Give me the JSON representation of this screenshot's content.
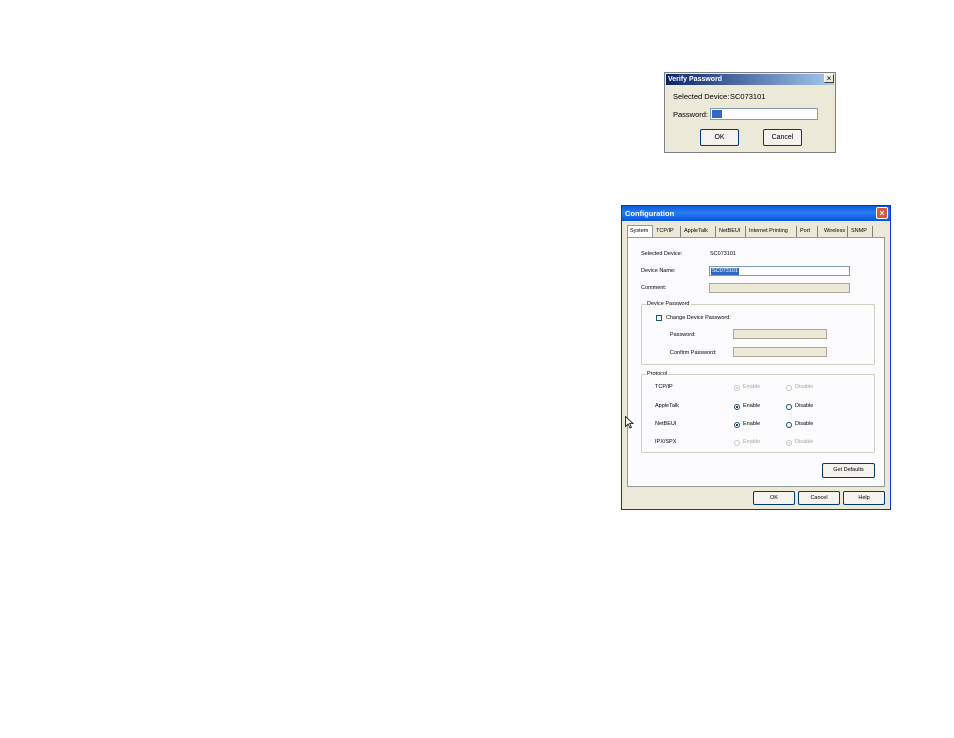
{
  "verify": {
    "title": "Verify Password",
    "close": "×",
    "device_label": "Selected Device:",
    "device_value": "SC073101",
    "password_label": "Password:",
    "ok": "OK",
    "cancel": "Cancel"
  },
  "config": {
    "title": "Configuration",
    "close": "×",
    "tabs": [
      "System",
      "TCP/IP",
      "AppleTalk",
      "NetBEUI",
      "Internet Printing",
      "Port",
      "Wireless",
      "SNMP"
    ],
    "selected_device_label": "Selected Device:",
    "selected_device_value": "SC073101",
    "device_name_label": "Device Name:",
    "device_name_value": "SC073101",
    "comment_label": "Comment:",
    "device_password_group": "Device Password",
    "change_password_label": "Change Device Password:",
    "password_label": "Password:",
    "confirm_password_label": "Confirm Password:",
    "protocol_group": "Protocol",
    "protocols": [
      {
        "name": "TCP/IP",
        "enable": "Enable",
        "disable": "Disable",
        "selected": "enable",
        "disabled": true
      },
      {
        "name": "AppleTalk",
        "enable": "Enable",
        "disable": "Disable",
        "selected": "enable",
        "disabled": false
      },
      {
        "name": "NetBEUI",
        "enable": "Enable",
        "disable": "Disable",
        "selected": "enable",
        "disabled": false
      },
      {
        "name": "IPX/SPX",
        "enable": "Enable",
        "disable": "Disable",
        "selected": "disable",
        "disabled": true
      }
    ],
    "get_defaults": "Get Defaults",
    "ok": "OK",
    "cancel": "Cancel",
    "help": "Help"
  }
}
